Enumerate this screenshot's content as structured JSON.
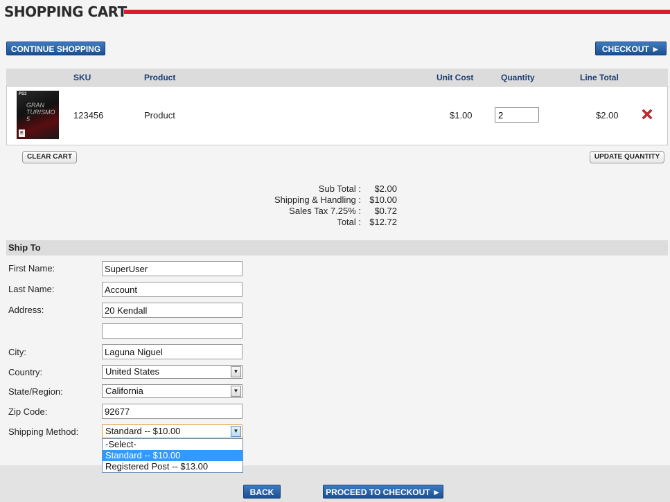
{
  "header": {
    "title": "SHOPPING CART"
  },
  "actions": {
    "continue_shopping": "CONTINUE SHOPPING",
    "checkout": "CHECKOUT ►",
    "clear_cart": "CLEAR CART",
    "update_quantity": "UPDATE QUANTITY",
    "back": "BACK",
    "proceed_to_checkout": "PROCEED TO CHECKOUT ►"
  },
  "cart": {
    "columns": {
      "sku": "SKU",
      "product": "Product",
      "unit_cost": "Unit Cost",
      "quantity": "Quantity",
      "line_total": "Line Total"
    },
    "items": [
      {
        "thumb_platform": "PS3",
        "thumb_title": "GRAN TURISMO 5",
        "thumb_rating": "E",
        "sku": "123456",
        "product": "Product",
        "unit_cost": "$1.00",
        "quantity": "2",
        "line_total": "$2.00",
        "remove_icon": "red-x-icon"
      }
    ]
  },
  "totals": {
    "subtotal_label": "Sub Total :",
    "subtotal": "$2.00",
    "shipping_label": "Shipping & Handling :",
    "shipping": "$10.00",
    "tax_label": "Sales Tax 7.25% :",
    "tax": "$0.72",
    "total_label": "Total :",
    "total": "$12.72"
  },
  "ship_to": {
    "heading": "Ship To",
    "first_name_label": "First Name:",
    "first_name": "SuperUser",
    "last_name_label": "Last Name:",
    "last_name": "Account",
    "address_label": "Address:",
    "address1": "20 Kendall",
    "address2": "",
    "city_label": "City:",
    "city": "Laguna Niguel",
    "country_label": "Country:",
    "country": "United States",
    "state_label": "State/Region:",
    "state": "California",
    "zip_label": "Zip Code:",
    "zip": "92677",
    "shipping_method_label": "Shipping Method:",
    "shipping_method": "Standard -- $10.00",
    "shipping_options": [
      "-Select-",
      "Standard -- $10.00",
      "Registered Post -- $13.00"
    ],
    "shipping_selected_index": 1
  },
  "colors": {
    "accent_red": "#d2202f",
    "button_blue": "#1c4f90",
    "header_text": "#1b3d73",
    "dropdown_highlight": "#3399ff"
  }
}
